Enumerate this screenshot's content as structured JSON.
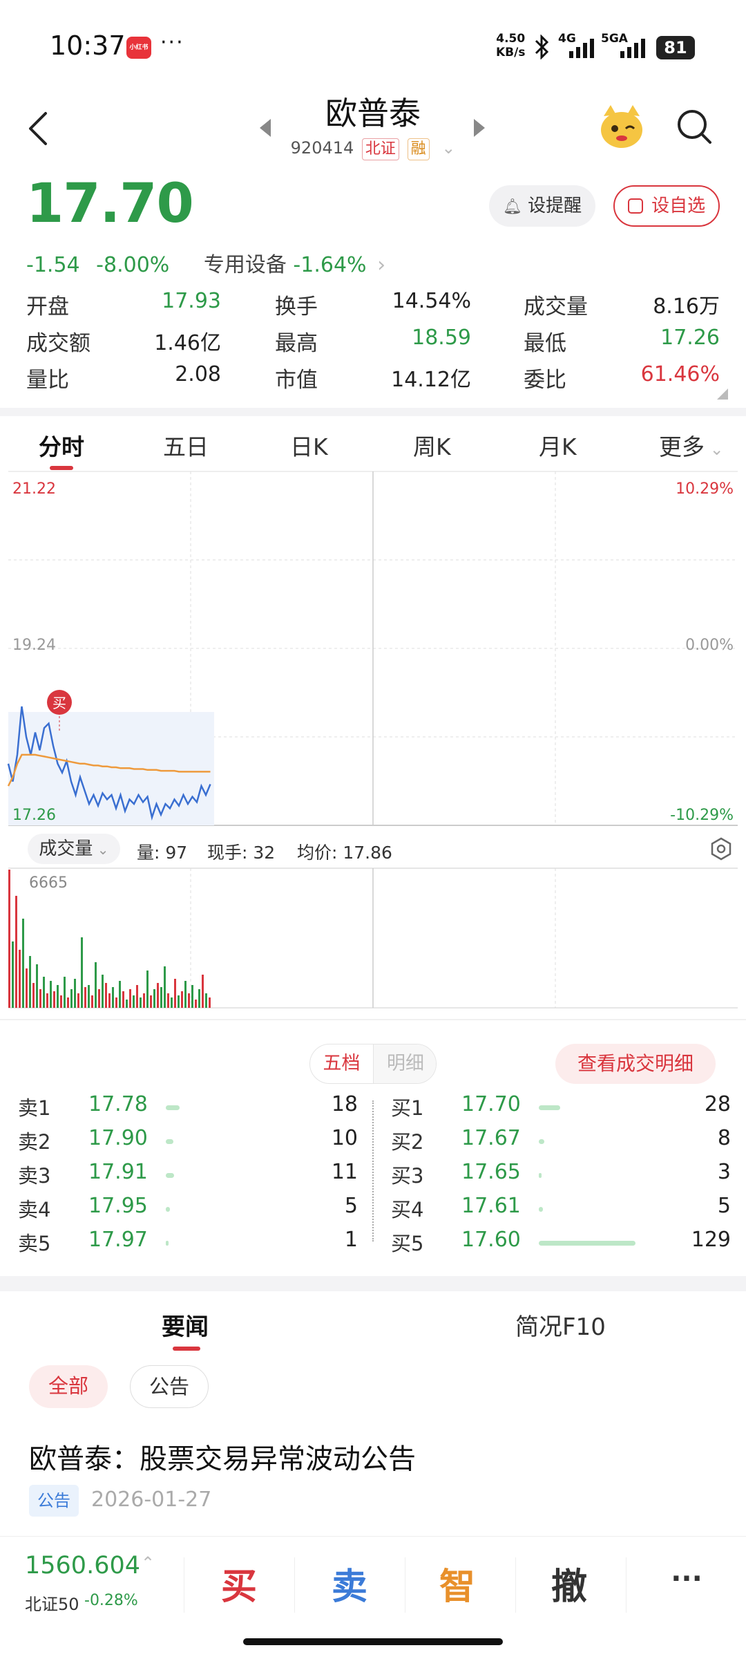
{
  "status_bar": {
    "time": "10:37",
    "app_badge": "小红书",
    "more": "···",
    "net_speed_value": "4.50",
    "net_speed_unit": "KB/s",
    "network": "4G",
    "network2": "5GA",
    "battery": "81"
  },
  "header": {
    "title": "欧普泰",
    "code": "920414",
    "tag_exchange": "北证",
    "tag_margin": "融"
  },
  "quote": {
    "price": "17.70",
    "change": "-1.54",
    "change_pct": "-8.00%",
    "sector": "专用设备",
    "sector_pct": "-1.64%",
    "remind_label": "设提醒",
    "fav_label": "设自选"
  },
  "stats": [
    {
      "label": "开盘",
      "value": "17.93",
      "color": "#2e9a49"
    },
    {
      "label": "换手",
      "value": "14.54%",
      "color": "#222222"
    },
    {
      "label": "成交量",
      "value": "8.16万",
      "color": "#222222"
    },
    {
      "label": "成交额",
      "value": "1.46亿",
      "color": "#222222"
    },
    {
      "label": "最高",
      "value": "18.59",
      "color": "#2e9a49"
    },
    {
      "label": "最低",
      "value": "17.26",
      "color": "#2e9a49"
    },
    {
      "label": "量比",
      "value": "2.08",
      "color": "#222222"
    },
    {
      "label": "市值",
      "value": "14.12亿",
      "color": "#222222"
    },
    {
      "label": "委比",
      "value": "61.46%",
      "color": "#d9363e"
    }
  ],
  "tabs": [
    "分时",
    "五日",
    "日K",
    "周K",
    "月K",
    "更多"
  ],
  "chart_labels": {
    "top_price": "21.22",
    "mid_price": "19.24",
    "bottom_price": "17.26",
    "top_pct": "10.29%",
    "mid_pct": "0.00%",
    "bottom_pct": "-10.29%",
    "buy_marker": "买",
    "vol_max": "6665"
  },
  "volume_bar": {
    "select_label": "成交量",
    "vol": "量: 97",
    "hand": "现手: 32",
    "avg": "均价: 17.86"
  },
  "chart_data": {
    "type": "line",
    "y_range": [
      17.26,
      21.22
    ],
    "series": [
      {
        "values": [
          17.95,
          17.75,
          18.05,
          18.59,
          18.25,
          18.05,
          18.3,
          18.1,
          18.35,
          18.4,
          18.15,
          17.95,
          17.85,
          17.98,
          17.75,
          17.6,
          17.8,
          17.65,
          17.5,
          17.6,
          17.48,
          17.62,
          17.55,
          17.6,
          17.45,
          17.6,
          17.42,
          17.55,
          17.5,
          17.6,
          17.52,
          17.58,
          17.35,
          17.5,
          17.38,
          17.5,
          17.45,
          17.55,
          17.48,
          17.6,
          17.5,
          17.58,
          17.52,
          17.7,
          17.6,
          17.72
        ]
      },
      {
        "values": [
          17.7,
          17.8,
          17.95,
          18.05,
          18.05,
          18.05,
          18.05,
          18.04,
          18.03,
          18.02,
          18.01,
          18.0,
          17.99,
          17.98,
          17.97,
          17.96,
          17.95,
          17.95,
          17.94,
          17.93,
          17.93,
          17.92,
          17.92,
          17.91,
          17.91,
          17.9,
          17.9,
          17.9,
          17.89,
          17.89,
          17.89,
          17.88,
          17.88,
          17.88,
          17.87,
          17.87,
          17.87,
          17.87,
          17.86,
          17.86,
          17.86,
          17.86,
          17.86,
          17.86,
          17.86,
          17.86
        ]
      }
    ],
    "volume_max": 6665,
    "volume": [
      6665,
      3200,
      5400,
      2800,
      4300,
      1900,
      2500,
      1200,
      2100,
      900,
      1500,
      700,
      1300,
      800,
      1100,
      600,
      1500,
      500,
      900,
      1400,
      700,
      3400,
      1000,
      1100,
      600,
      2200,
      900,
      1600,
      1200,
      700,
      1000,
      500,
      1300,
      800,
      400,
      900,
      600,
      1100,
      500,
      700,
      1800,
      600,
      900,
      1200,
      1000,
      2000,
      700,
      500,
      1400,
      600,
      800,
      1300,
      700,
      1100,
      400,
      900,
      1600,
      700,
      500
    ],
    "volume_colors": [
      "r",
      "g",
      "r",
      "r",
      "g",
      "r",
      "g",
      "r",
      "g",
      "r",
      "g",
      "r",
      "g",
      "r",
      "g",
      "r",
      "g",
      "r",
      "g",
      "g",
      "r",
      "g",
      "r",
      "g",
      "r",
      "g",
      "r",
      "g",
      "r",
      "r",
      "g",
      "r",
      "g",
      "r",
      "g",
      "r",
      "g",
      "r",
      "g",
      "r",
      "g",
      "r",
      "g",
      "r",
      "g",
      "g",
      "r",
      "g",
      "r",
      "g",
      "r",
      "g",
      "r",
      "g",
      "r",
      "g",
      "r",
      "g",
      "r"
    ]
  },
  "order_book": {
    "toggle_active": "五档",
    "toggle_inactive": "明细",
    "view_detail": "查看成交明细",
    "sells": [
      {
        "label": "卖1",
        "price": "17.78",
        "qty": "18",
        "ratio": 0.14
      },
      {
        "label": "卖2",
        "price": "17.90",
        "qty": "10",
        "ratio": 0.08
      },
      {
        "label": "卖3",
        "price": "17.91",
        "qty": "11",
        "ratio": 0.085
      },
      {
        "label": "卖4",
        "price": "17.95",
        "qty": "5",
        "ratio": 0.04
      },
      {
        "label": "卖5",
        "price": "17.97",
        "qty": "1",
        "ratio": 0.01
      }
    ],
    "buys": [
      {
        "label": "买1",
        "price": "17.70",
        "qty": "28",
        "ratio": 0.22
      },
      {
        "label": "买2",
        "price": "17.67",
        "qty": "8",
        "ratio": 0.06
      },
      {
        "label": "买3",
        "price": "17.65",
        "qty": "3",
        "ratio": 0.025
      },
      {
        "label": "买4",
        "price": "17.61",
        "qty": "5",
        "ratio": 0.04
      },
      {
        "label": "买5",
        "price": "17.60",
        "qty": "129",
        "ratio": 1.0
      }
    ]
  },
  "news": {
    "tab_active": "要闻",
    "tab_other": "简况F10",
    "filter_all": "全部",
    "filter_notice": "公告",
    "item_title": "欧普泰：股票交易异常波动公告",
    "item_tag": "公告",
    "item_date": "2026-01-27"
  },
  "bottom_bar": {
    "index_value": "1560.604",
    "index_name": "北证50",
    "index_change": "-0.28%",
    "buy": "买",
    "sell": "卖",
    "smart": "智",
    "cancel": "撤",
    "more": "···"
  },
  "colors": {
    "up": "#d9363e",
    "down": "#2e9a49",
    "price_line": "#3a6fd1",
    "avg_line": "#ee9a3c",
    "buy_action": "#d9363e",
    "sell_action": "#3b7bd8",
    "smart_action": "#e8902b",
    "cancel_action": "#333333"
  }
}
